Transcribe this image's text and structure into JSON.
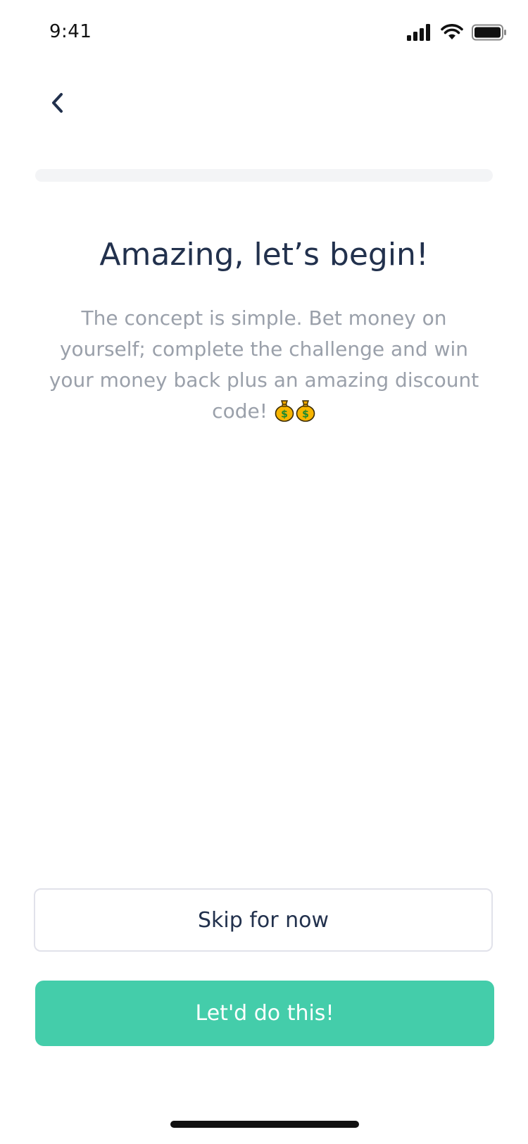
{
  "status_bar": {
    "time": "9:41",
    "icons": [
      "signal-icon",
      "wifi-icon",
      "battery-icon"
    ]
  },
  "header": {
    "back_icon": "chevron-left-icon"
  },
  "progress": {
    "fraction": 0,
    "track_color": "#f3f4f6",
    "fill_color": "#44cdaa"
  },
  "main": {
    "title": "Amazing, let’s begin!",
    "description": "The concept is simple. Bet money on yourself; complete the challenge and win your money back plus an amazing discount code!",
    "description_icons": [
      "money-bag-icon",
      "money-bag-icon"
    ]
  },
  "actions": {
    "skip_label": "Skip for now",
    "primary_label": "Let'd do this!"
  },
  "colors": {
    "accent": "#44cdaa",
    "title_text": "#22314d",
    "body_text": "#9aa0aa",
    "border": "#e1e2ea"
  }
}
